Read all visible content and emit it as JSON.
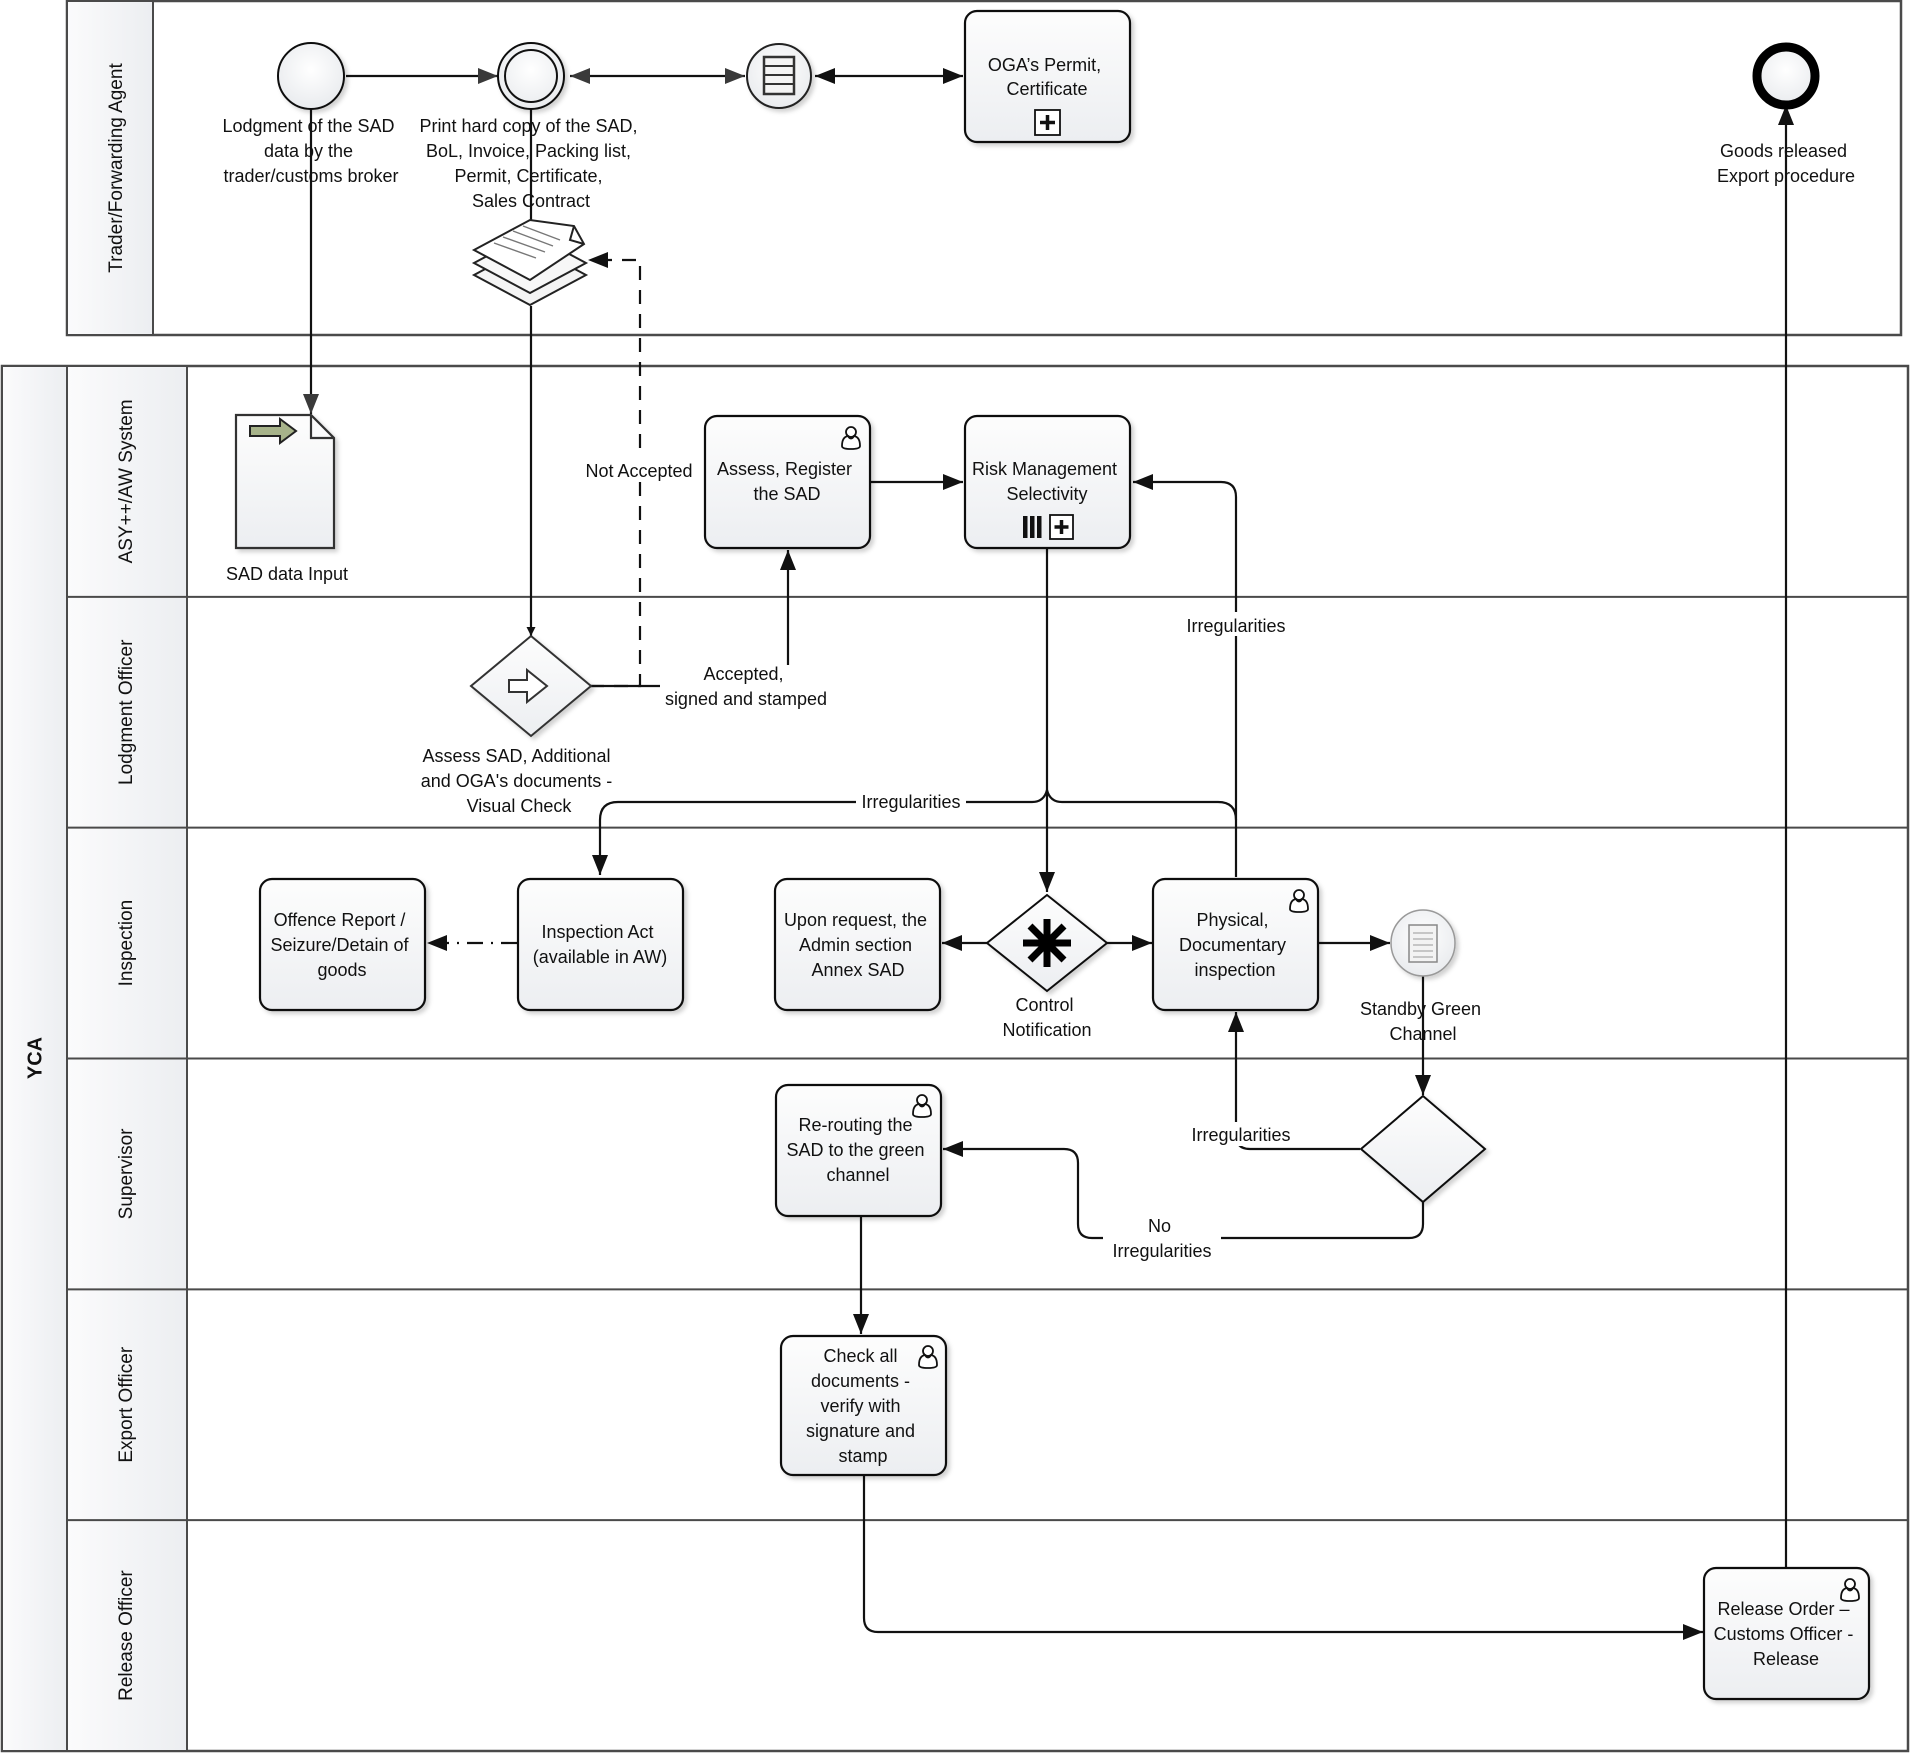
{
  "pools": {
    "trader": {
      "label": "Trader/Forwarding Agent"
    },
    "yca": {
      "label": "YCA"
    }
  },
  "lanes": [
    {
      "id": "asy",
      "label": "ASY++/AW System"
    },
    {
      "id": "lodgment",
      "label": "Lodgment Officer"
    },
    {
      "id": "inspection",
      "label": "Inspection"
    },
    {
      "id": "supervisor",
      "label": "Supervisor"
    },
    {
      "id": "export",
      "label": "Export Officer"
    },
    {
      "id": "release",
      "label": "Release Officer"
    }
  ],
  "nodes": {
    "start_event": {
      "type": "start-event",
      "label": [
        "Lodgment of the SAD",
        "data by the",
        "trader/customs broker"
      ]
    },
    "intermediate_event": {
      "type": "intermediate-event",
      "label": [
        "Print hard copy of the SAD,",
        "BoL, Invoice, Packing list,",
        "Permit, Certificate,",
        "Sales Contract"
      ]
    },
    "conditional_event": {
      "type": "intermediate-conditional-event",
      "icon": "list-icon"
    },
    "oga_permit": {
      "type": "collapsed-subprocess",
      "label": [
        "OGA’s Permit,",
        "Certificate"
      ],
      "marker": "plus"
    },
    "end_event": {
      "type": "end-event",
      "label": [
        "Goods released",
        "Export procedure"
      ]
    },
    "documents": {
      "type": "data-object-collection",
      "icon": "documents-stack-icon"
    },
    "sad_input": {
      "type": "data-input",
      "label": [
        "SAD data Input"
      ],
      "arrow_color": "#a7b38a"
    },
    "assess_register": {
      "type": "user-task",
      "label": [
        "Assess, Register",
        "the SAD"
      ]
    },
    "risk_management": {
      "type": "parallel-multi-subprocess",
      "label": [
        "Risk Management",
        "Selectivity"
      ],
      "marker": "parallel-plus"
    },
    "visual_check": {
      "type": "event-based-gateway",
      "label": [
        "Assess SAD, Additional",
        "and OGA's documents -",
        "Visual Check"
      ]
    },
    "offence_report": {
      "type": "task",
      "label": [
        "Offence Report /",
        "Seizure/Detain of",
        "goods"
      ]
    },
    "inspection_act": {
      "type": "task",
      "label": [
        "Inspection Act",
        "(available in AW)"
      ]
    },
    "admin_annex": {
      "type": "task",
      "label": [
        "Upon request, the",
        "Admin section",
        "Annex SAD"
      ]
    },
    "control_gateway": {
      "type": "complex-gateway",
      "label": [
        "Control",
        "Notification"
      ]
    },
    "physical_inspection": {
      "type": "user-task",
      "label": [
        "Physical,",
        "Documentary",
        "inspection"
      ]
    },
    "standby_green": {
      "type": "intermediate-message-event",
      "label": [
        "Standby Green",
        "Channel"
      ]
    },
    "supervisor_gateway": {
      "type": "exclusive-gateway"
    },
    "rerouting": {
      "type": "user-task",
      "label": [
        "Re-routing the",
        "SAD to the green",
        "channel"
      ]
    },
    "check_documents": {
      "type": "user-task",
      "label": [
        "Check all",
        "documents -",
        "verify with",
        "signature and",
        "stamp"
      ]
    },
    "release_order": {
      "type": "user-task",
      "label": [
        "Release Order –",
        "Customs Officer -",
        "Release"
      ]
    }
  },
  "flow_labels": {
    "not_accepted": "Not Accepted",
    "accepted": [
      "Accepted,",
      "signed and stamped"
    ],
    "irregularities_top": "Irregularities",
    "irregularities_mid": "Irregularities",
    "irregularities_sup": "Irregularities",
    "no_irregularities": [
      "No",
      "Irregularities"
    ]
  },
  "colors": {
    "frame": "#4a4a4a",
    "lane_header_bg": "#eef0f3",
    "task_fill_top": "#fdfdfd",
    "task_fill_bottom": "#eceef1",
    "stroke": "#111111",
    "data_input_arrow": "#a7b38a"
  }
}
